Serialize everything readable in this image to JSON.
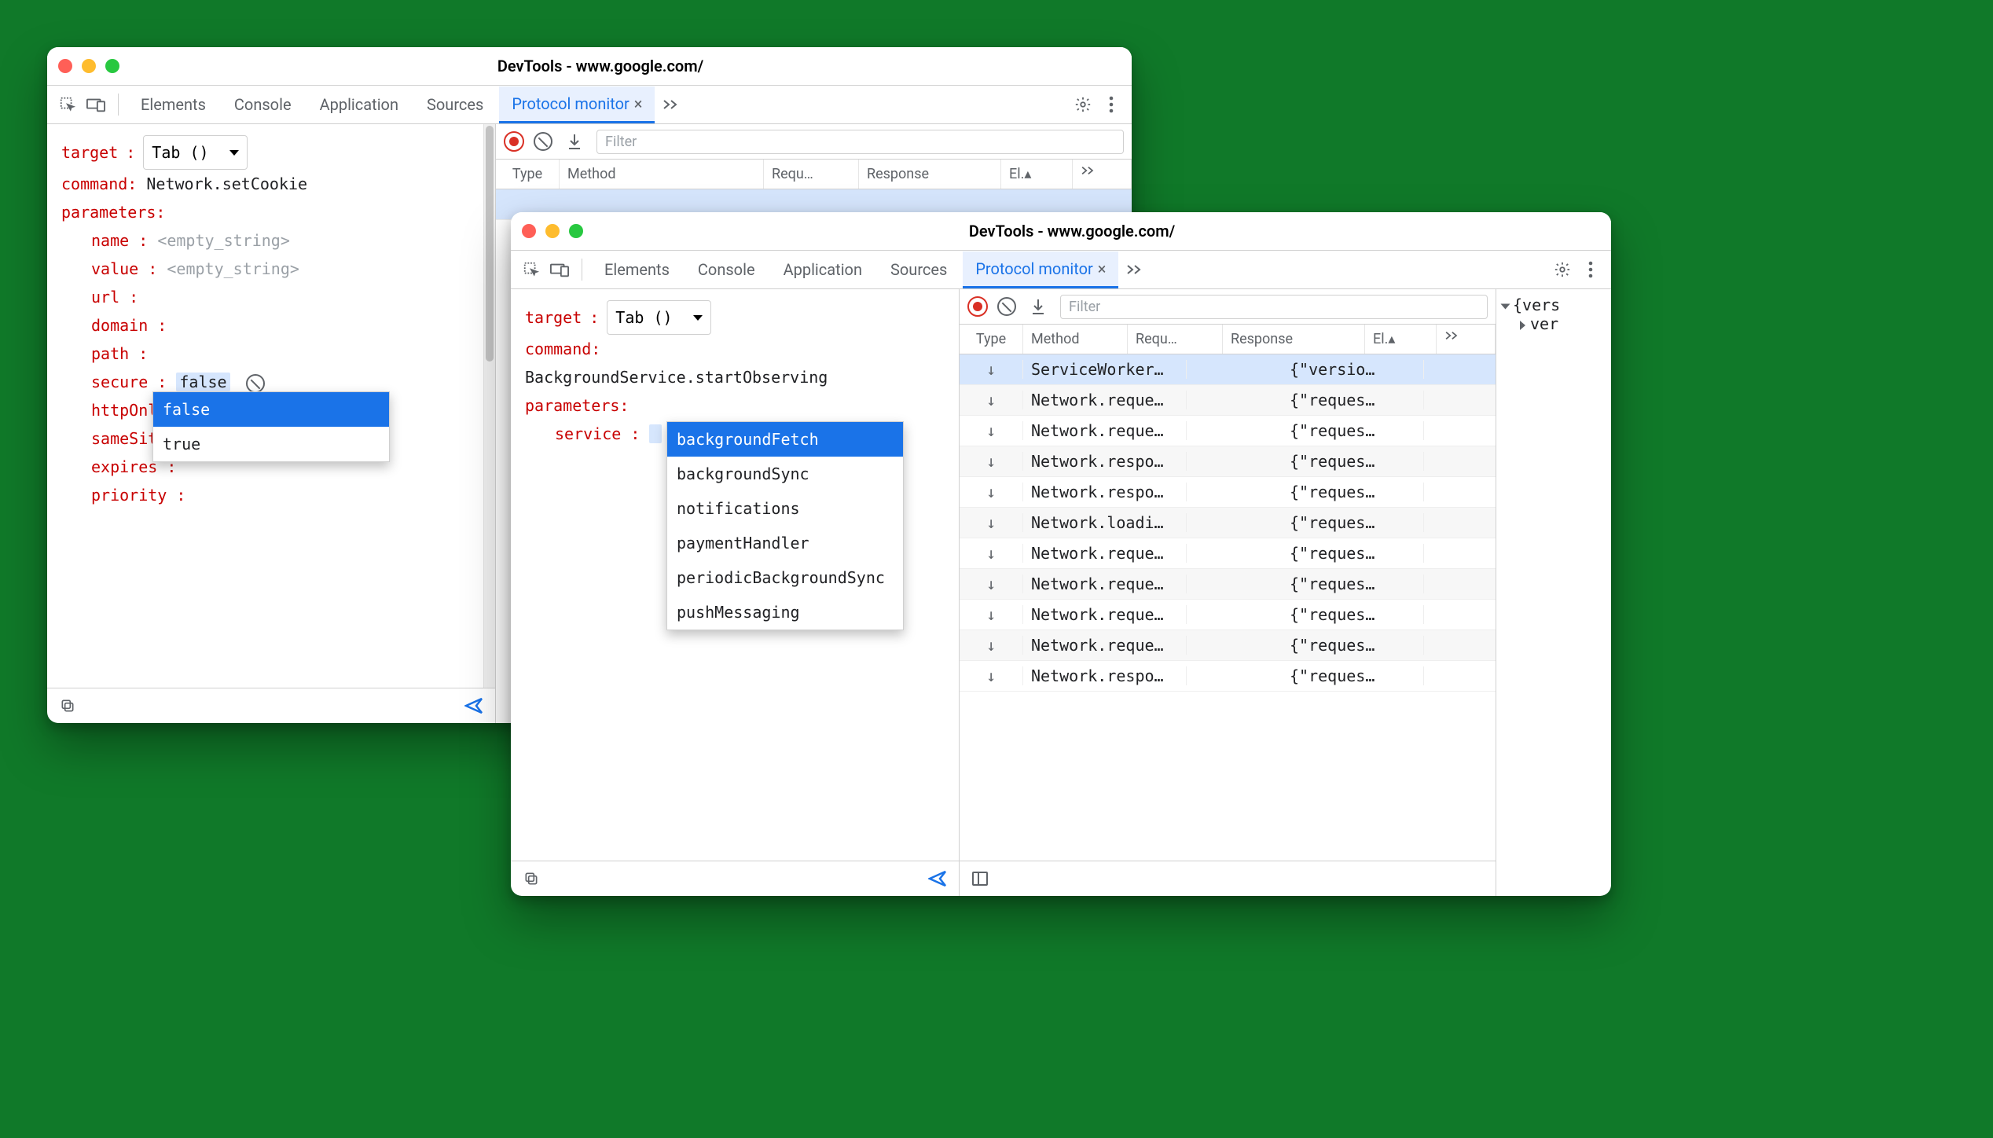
{
  "window1": {
    "title": "DevTools - www.google.com/",
    "tabs": [
      "Elements",
      "Console",
      "Application",
      "Sources",
      "Protocol monitor"
    ],
    "active_tab": 4,
    "editor": {
      "target_label": "target",
      "target_value": "Tab ()",
      "command_label": "command",
      "command_value": "Network.setCookie",
      "parameters_label": "parameters",
      "params": {
        "name": {
          "label": "name",
          "placeholder": "<empty_string>"
        },
        "value": {
          "label": "value",
          "placeholder": "<empty_string>"
        },
        "url": {
          "label": "url",
          "placeholder": ""
        },
        "domain": {
          "label": "domain",
          "placeholder": ""
        },
        "path": {
          "label": "path",
          "placeholder": ""
        },
        "secure": {
          "label": "secure",
          "value": "false"
        },
        "httpOnly": {
          "label": "httpOnly",
          "placeholder": ""
        },
        "sameSite": {
          "label": "sameSite",
          "placeholder": ""
        },
        "expires": {
          "label": "expires",
          "placeholder": ""
        },
        "priority": {
          "label": "priority",
          "placeholder": ""
        }
      },
      "autocomplete": [
        "false",
        "true"
      ],
      "autocomplete_selected": 0
    },
    "grid": {
      "filter_placeholder": "Filter",
      "cols": [
        "Type",
        "Method",
        "Requ…",
        "Response",
        "El.▴",
        ""
      ]
    }
  },
  "window2": {
    "title": "DevTools - www.google.com/",
    "tabs": [
      "Elements",
      "Console",
      "Application",
      "Sources",
      "Protocol monitor"
    ],
    "active_tab": 4,
    "editor": {
      "target_label": "target",
      "target_value": "Tab ()",
      "command_label": "command",
      "command_value": "BackgroundService.startObserving",
      "parameters_label": "parameters",
      "service_label": "service",
      "autocomplete": [
        "backgroundFetch",
        "backgroundSync",
        "notifications",
        "paymentHandler",
        "periodicBackgroundSync",
        "pushMessaging"
      ],
      "autocomplete_selected": 0
    },
    "grid": {
      "filter_placeholder": "Filter",
      "cols": [
        "Type",
        "Method",
        "Requ…",
        "Response",
        "El.▴",
        ""
      ],
      "rows": [
        {
          "method": "ServiceWorker…",
          "response": "{\"versio…",
          "selected": true
        },
        {
          "method": "Network.reque…",
          "response": "{\"reques…"
        },
        {
          "method": "Network.reque…",
          "response": "{\"reques…"
        },
        {
          "method": "Network.respo…",
          "response": "{\"reques…"
        },
        {
          "method": "Network.respo…",
          "response": "{\"reques…"
        },
        {
          "method": "Network.loadi…",
          "response": "{\"reques…"
        },
        {
          "method": "Network.reque…",
          "response": "{\"reques…"
        },
        {
          "method": "Network.reque…",
          "response": "{\"reques…"
        },
        {
          "method": "Network.reque…",
          "response": "{\"reques…"
        },
        {
          "method": "Network.reque…",
          "response": "{\"reques…"
        },
        {
          "method": "Network.respo…",
          "response": "{\"reques…"
        }
      ],
      "details": {
        "root": "{vers",
        "child": "ver"
      }
    }
  }
}
